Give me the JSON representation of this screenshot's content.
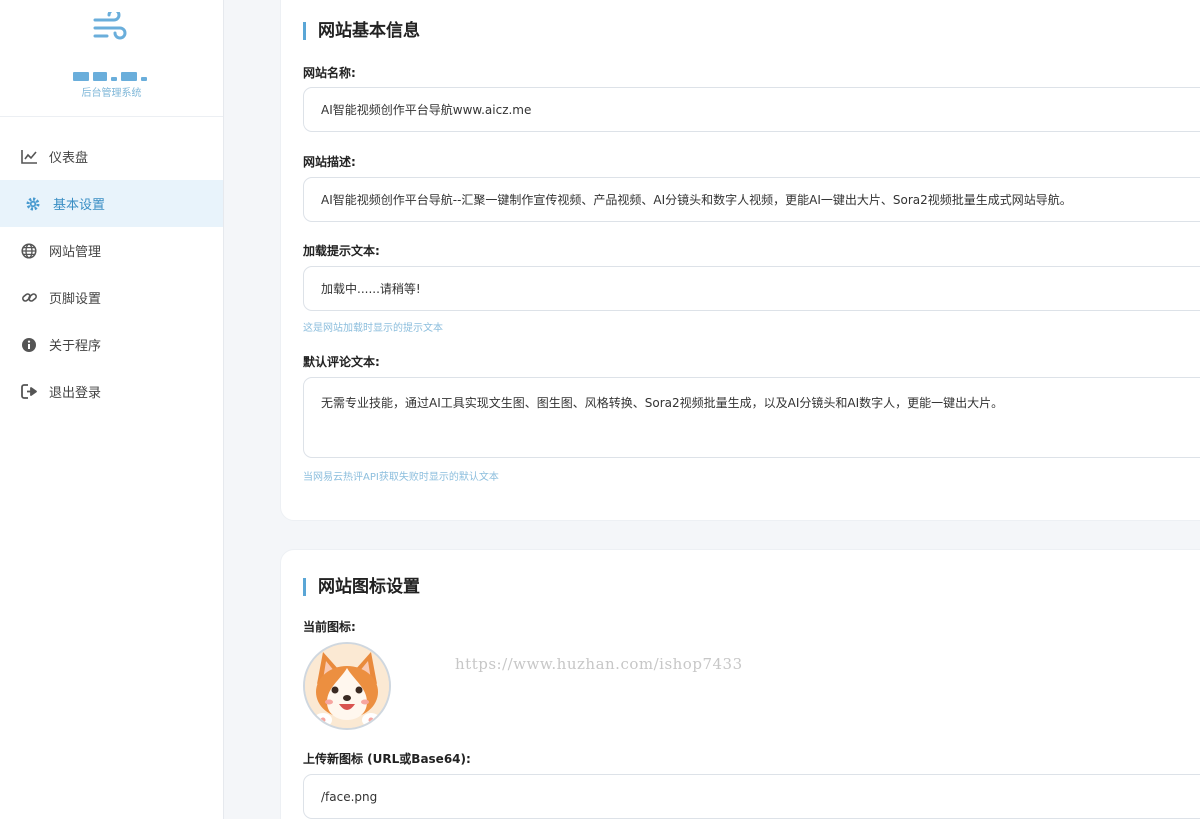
{
  "sidebar": {
    "brand_subtitle": "后台管理系统",
    "items": [
      {
        "label": "仪表盘",
        "icon": "chart-line-icon"
      },
      {
        "label": "基本设置",
        "icon": "gear-icon"
      },
      {
        "label": "网站管理",
        "icon": "globe-icon"
      },
      {
        "label": "页脚设置",
        "icon": "link-icon"
      },
      {
        "label": "关于程序",
        "icon": "info-icon"
      },
      {
        "label": "退出登录",
        "icon": "logout-icon"
      }
    ]
  },
  "basic": {
    "title": "网站基本信息",
    "site_name_label": "网站名称:",
    "site_name_value": "AI智能视频创作平台导航www.aicz.me",
    "site_desc_label": "网站描述:",
    "site_desc_value": "AI智能视频创作平台导航--汇聚一键制作宣传视频、产品视频、AI分镜头和数字人视频，更能AI一键出大片、Sora2视频批量生成式网站导航。",
    "loading_label": "加载提示文本:",
    "loading_value": "加载中......请稍等!",
    "loading_hint": "这是网站加载时显示的提示文本",
    "comment_label": "默认评论文本:",
    "comment_value": "无需专业技能，通过AI工具实现文生图、图生图、风格转换、Sora2视频批量生成，以及AI分镜头和AI数字人，更能一键出大片。",
    "comment_hint": "当网易云热评API获取失败时显示的默认文本"
  },
  "icon_settings": {
    "title": "网站图标设置",
    "current_label": "当前图标:",
    "upload_label": "上传新图标 (URL或Base64):",
    "upload_value": "/face.png"
  },
  "watermark": "https://www.huzhan.com/ishop7433",
  "colors": {
    "accent": "#5aa6d6",
    "active_bg": "#e8f3fb"
  }
}
